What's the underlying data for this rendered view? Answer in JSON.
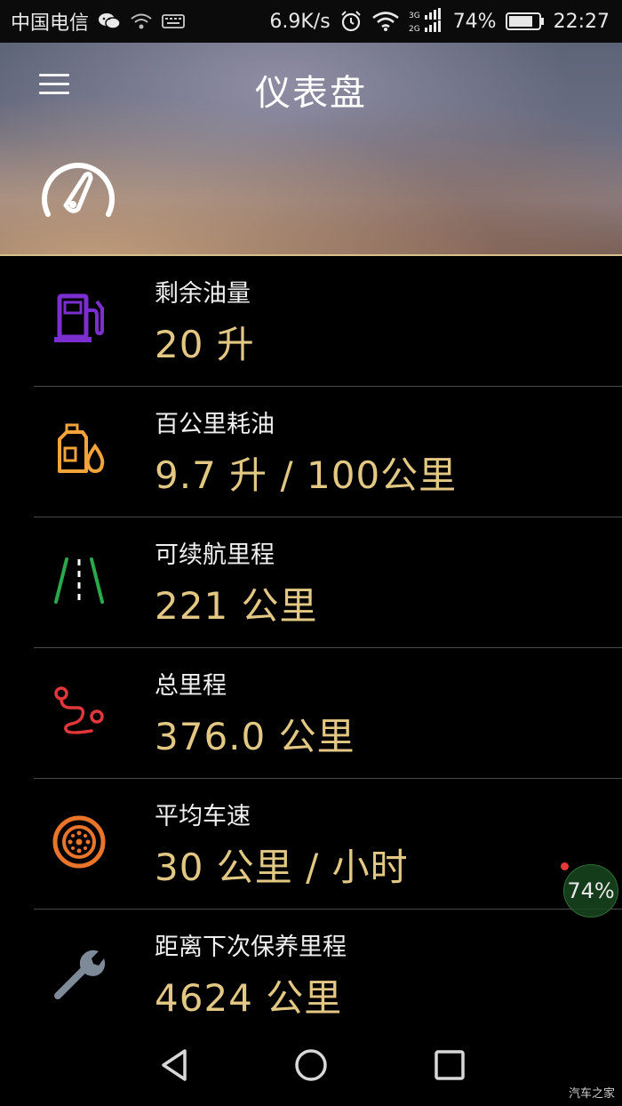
{
  "status_bar": {
    "carrier": "中国电信",
    "speed": "6.9K/s",
    "network": "3G 2G",
    "battery": "74%",
    "time": "22:27"
  },
  "header": {
    "title": "仪表盘"
  },
  "items": [
    {
      "label": "剩余油量",
      "value": "20 升",
      "icon": "fuel-pump-icon",
      "color": "#7b2fd1"
    },
    {
      "label": "百公里耗油",
      "value": "9.7 升 / 100公里",
      "icon": "oil-can-icon",
      "color": "#f2a33a"
    },
    {
      "label": "可续航里程",
      "value": "221 公里",
      "icon": "road-icon",
      "color": "#2aa84a"
    },
    {
      "label": "总里程",
      "value": "376.0 公里",
      "icon": "route-icon",
      "color": "#e0373b"
    },
    {
      "label": "平均车速",
      "value": "30 公里 / 小时",
      "icon": "wheel-icon",
      "color": "#e8752a"
    },
    {
      "label": "距离下次保养里程",
      "value": "4624 公里",
      "icon": "wrench-icon",
      "color": "#7f8a98"
    }
  ],
  "floating_badge": {
    "value": "74%"
  },
  "watermark": "汽车之家",
  "colors": {
    "accent_value": "#e3c884",
    "background": "#000000"
  }
}
